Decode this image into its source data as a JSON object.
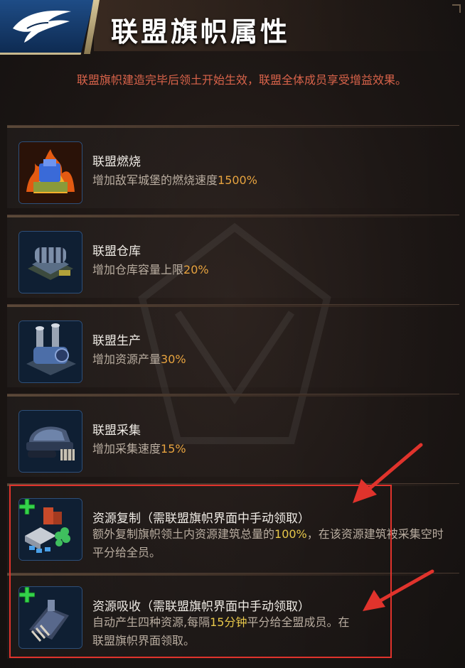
{
  "header": {
    "title": "联盟旗帜属性",
    "emblem_icon": "eagle-wing-icon"
  },
  "subtitle": "联盟旗帜建造完毕后领土开始生效，联盟全体成员享受增益效果。",
  "items": [
    {
      "icon": "burning-fortress-icon",
      "title": "联盟燃烧",
      "desc_prefix": "增加敌军城堡的燃烧速度",
      "desc_value": "1500%",
      "desc_suffix": ""
    },
    {
      "icon": "warehouse-icon",
      "title": "联盟仓库",
      "desc_prefix": "增加仓库容量上限",
      "desc_value": "20%",
      "desc_suffix": ""
    },
    {
      "icon": "refinery-icon",
      "title": "联盟生产",
      "desc_prefix": "增加资源产量",
      "desc_value": "30%",
      "desc_suffix": ""
    },
    {
      "icon": "harvester-icon",
      "title": "联盟采集",
      "desc_prefix": "增加采集速度",
      "desc_value": "15%",
      "desc_suffix": ""
    },
    {
      "icon": "resource-copy-icon",
      "title": "资源复制（需联盟旗帜界面中手动领取）",
      "desc_prefix": "额外复制旗帜领土内资源建筑总量的",
      "desc_value": "100%",
      "desc_suffix": "，在该资源建筑被采集空时平分给全员。"
    },
    {
      "icon": "resource-absorb-icon",
      "title": "资源吸收（需联盟旗帜界面中手动领取）",
      "desc_prefix": "自动产生四种资源,每隔",
      "desc_value": "15分钟",
      "desc_suffix": "平分给全盟成员。在联盟旗帜界面领取。"
    }
  ],
  "colors": {
    "accent_orange": "#e7a33f",
    "accent_yellow": "#e8c84a",
    "subtitle_red": "#d9634a",
    "annotation_red": "#e0332c"
  }
}
